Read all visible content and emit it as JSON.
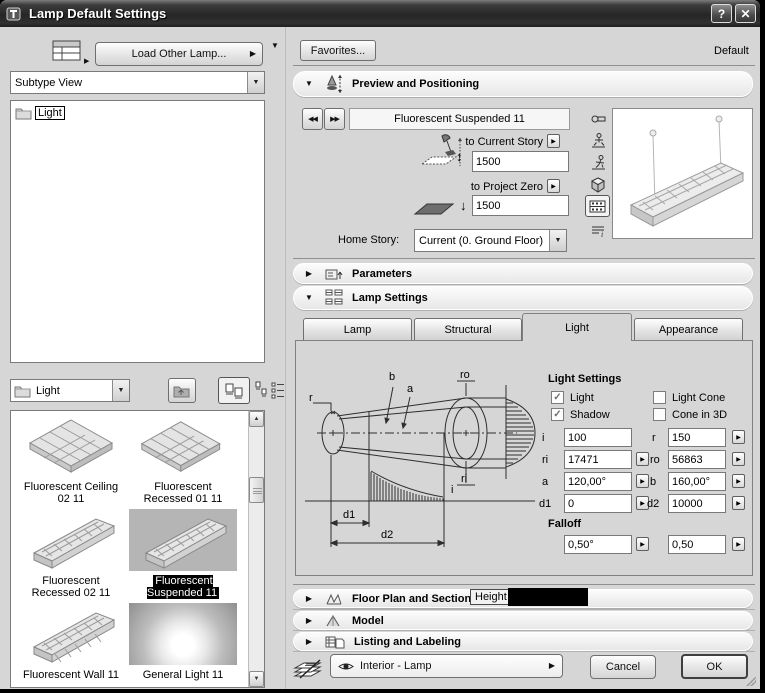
{
  "colors": {
    "dialog_bg": "#d6d6d6",
    "titlebar": "#2a2a2a",
    "selection_bg": "#000000",
    "selection_text": "#ffffff"
  },
  "icons": {
    "collapse": "▼",
    "expand": "▶",
    "dropdown": "▼",
    "spin": "▶",
    "back": "◀◀",
    "fwd": "▶▶",
    "check": "✓",
    "help": "?",
    "close": "✕",
    "updown": "↕",
    "down": "↓",
    "scroll_up": "▲",
    "scroll_down": "▼",
    "menu_arrow": "▶"
  },
  "window": {
    "title": "Lamp Default Settings"
  },
  "left": {
    "load_button": "Load Other Lamp...",
    "subtype_view": "Subtype View",
    "tree_root": "Light",
    "folder_value": "Light",
    "thumbnails": [
      {
        "line1": "Fluorescent Ceiling",
        "line2": "02 11",
        "selected": false
      },
      {
        "line1": "Fluorescent",
        "line2": "Recessed 01 11",
        "selected": false
      },
      {
        "line1": "Fluorescent",
        "line2": "Recessed 02 11",
        "selected": false
      },
      {
        "line1": "Fluorescent",
        "line2": "Suspended 11",
        "selected": true
      },
      {
        "line1": "Fluorescent Wall 11",
        "line2": "",
        "selected": false
      },
      {
        "line1": "General Light 11",
        "line2": "",
        "selected": false
      }
    ]
  },
  "header": {
    "favorites": "Favorites...",
    "default_label": "Default"
  },
  "preview": {
    "title": "Preview and Positioning",
    "item_name": "Fluorescent Suspended 11",
    "to_current_story": "to Current Story",
    "current_story_value": "1500",
    "to_project_zero": "to Project Zero",
    "project_zero_value": "1500",
    "home_story_label": "Home Story:",
    "home_story_value": "Current (0. Ground Floor)"
  },
  "sections": {
    "parameters": "Parameters",
    "lamp_settings": "Lamp Settings",
    "floor_plan": "Floor Plan and Section",
    "model": "Model",
    "listing": "Listing and Labeling"
  },
  "tabs": {
    "lamp": "Lamp",
    "structural": "Structural",
    "light": "Light",
    "appearance": "Appearance"
  },
  "light_tab": {
    "title": "Light Settings",
    "cb_light": "Light",
    "cb_light_checked": true,
    "cb_shadow": "Shadow",
    "cb_shadow_checked": true,
    "cb_light_cone": "Light Cone",
    "cb_light_cone_checked": false,
    "cb_cone_3d": "Cone in 3D",
    "cb_cone_3d_checked": false,
    "f_i_label": "i",
    "f_i": "100",
    "f_r_label": "r",
    "f_r": "150",
    "f_ri_label": "ri",
    "f_ri": "17471",
    "f_ro_label": "ro",
    "f_ro": "56863",
    "f_a_label": "a",
    "f_a": "120,00°",
    "f_b_label": "b",
    "f_b": "160,00°",
    "f_d1_label": "d1",
    "f_d1": "0",
    "f_d2_label": "d2",
    "f_d2": "10000",
    "falloff_title": "Falloff",
    "falloff1": "0,50°",
    "falloff2": "0,50",
    "diagram": {
      "r": "r",
      "b": "b",
      "a": "a",
      "ro": "ro",
      "ri": "ri",
      "i": "i",
      "d1": "d1",
      "d2": "d2"
    }
  },
  "tooltip": "Height",
  "footer": {
    "layer_value": "Interior - Lamp",
    "cancel": "Cancel",
    "ok": "OK"
  }
}
